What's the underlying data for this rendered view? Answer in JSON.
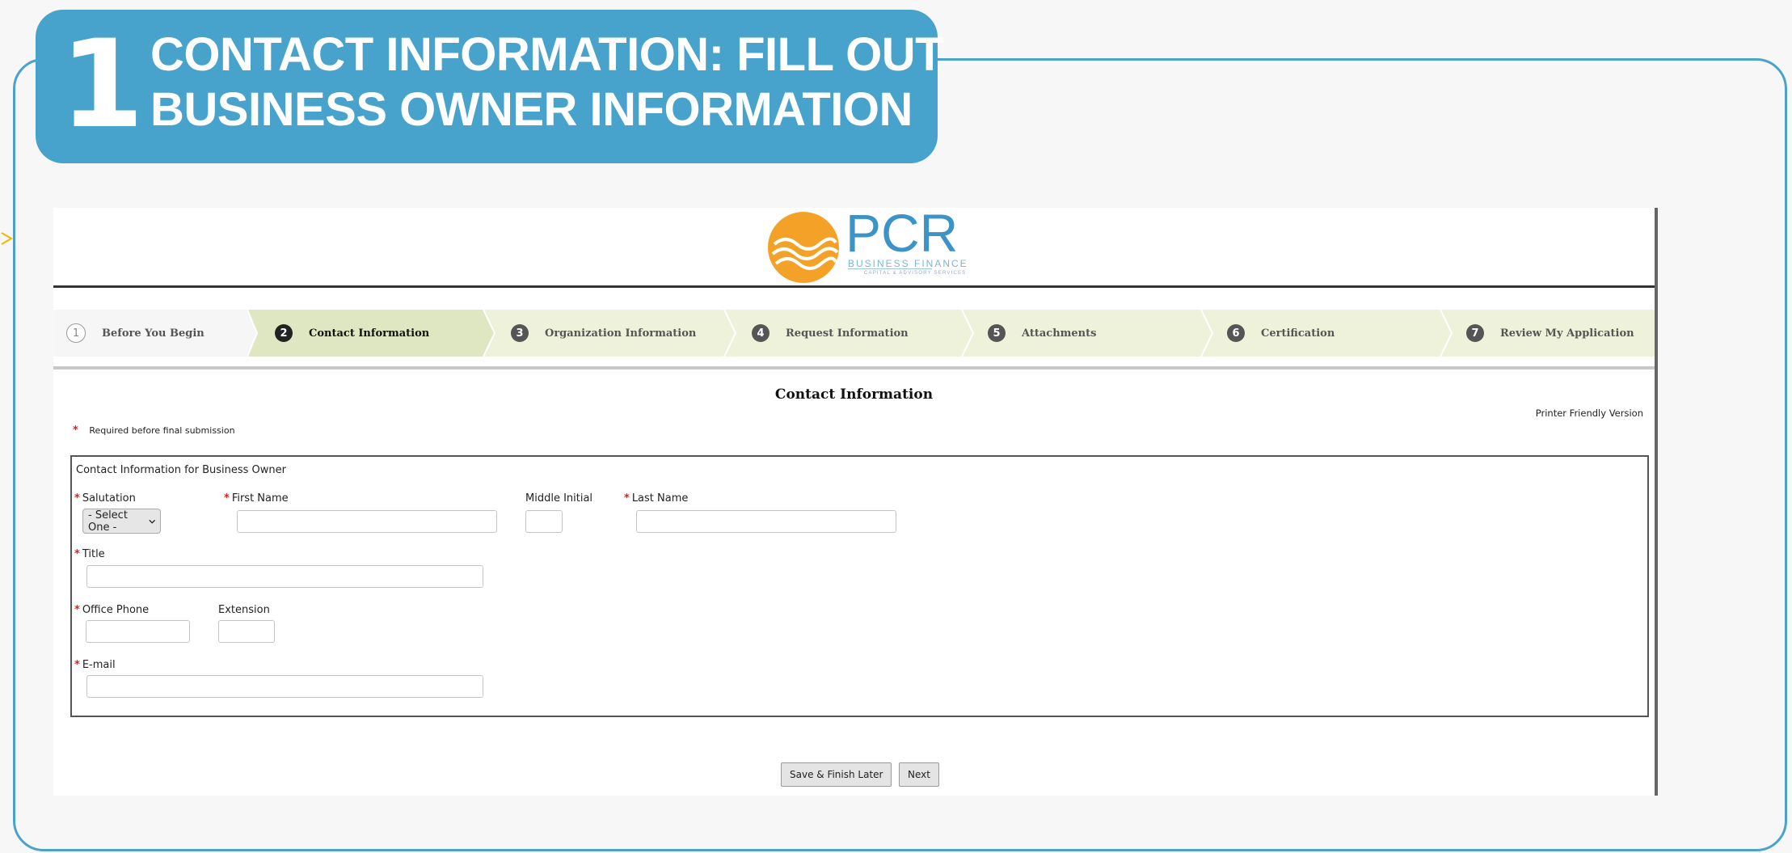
{
  "banner": {
    "step_number": "1",
    "title_line1": "CONTACT INFORMATION: FILL OUT",
    "title_line2": "BUSINESS OWNER INFORMATION"
  },
  "logo": {
    "word": "PCR",
    "subtitle": "BUSINESS FINANCE",
    "tagline": "CAPITAL & ADVISORY SERVICES"
  },
  "steps": [
    {
      "number": "1",
      "label": "Before You Begin",
      "state": "done"
    },
    {
      "number": "2",
      "label": "Contact Information",
      "state": "active"
    },
    {
      "number": "3",
      "label": "Organization Information",
      "state": "upcoming"
    },
    {
      "number": "4",
      "label": "Request Information",
      "state": "upcoming"
    },
    {
      "number": "5",
      "label": "Attachments",
      "state": "upcoming"
    },
    {
      "number": "6",
      "label": "Certification",
      "state": "upcoming"
    },
    {
      "number": "7",
      "label": "Review My Application",
      "state": "upcoming"
    }
  ],
  "page": {
    "heading": "Contact Information",
    "printer_link": "Printer Friendly Version",
    "required_note": "Required before final submission",
    "required_marker": "*"
  },
  "form": {
    "title": "Contact Information for Business Owner",
    "salutation_label": "Salutation",
    "salutation_value": "- Select One -",
    "first_name_label": "First Name",
    "first_name_value": "",
    "middle_initial_label": "Middle Initial",
    "middle_initial_value": "",
    "last_name_label": "Last Name",
    "last_name_value": "",
    "title_label": "Title",
    "title_value": "",
    "office_phone_label": "Office Phone",
    "office_phone_value": "",
    "extension_label": "Extension",
    "extension_value": "",
    "email_label": "E-mail",
    "email_value": ""
  },
  "buttons": {
    "save_label": "Save & Finish Later",
    "next_label": "Next"
  },
  "colors": {
    "brand_blue": "#47a3cc",
    "step_active_bg": "#dfe7c2",
    "step_bg": "#eef2da",
    "required_red": "#dd2222",
    "logo_orange": "#f4a227"
  }
}
